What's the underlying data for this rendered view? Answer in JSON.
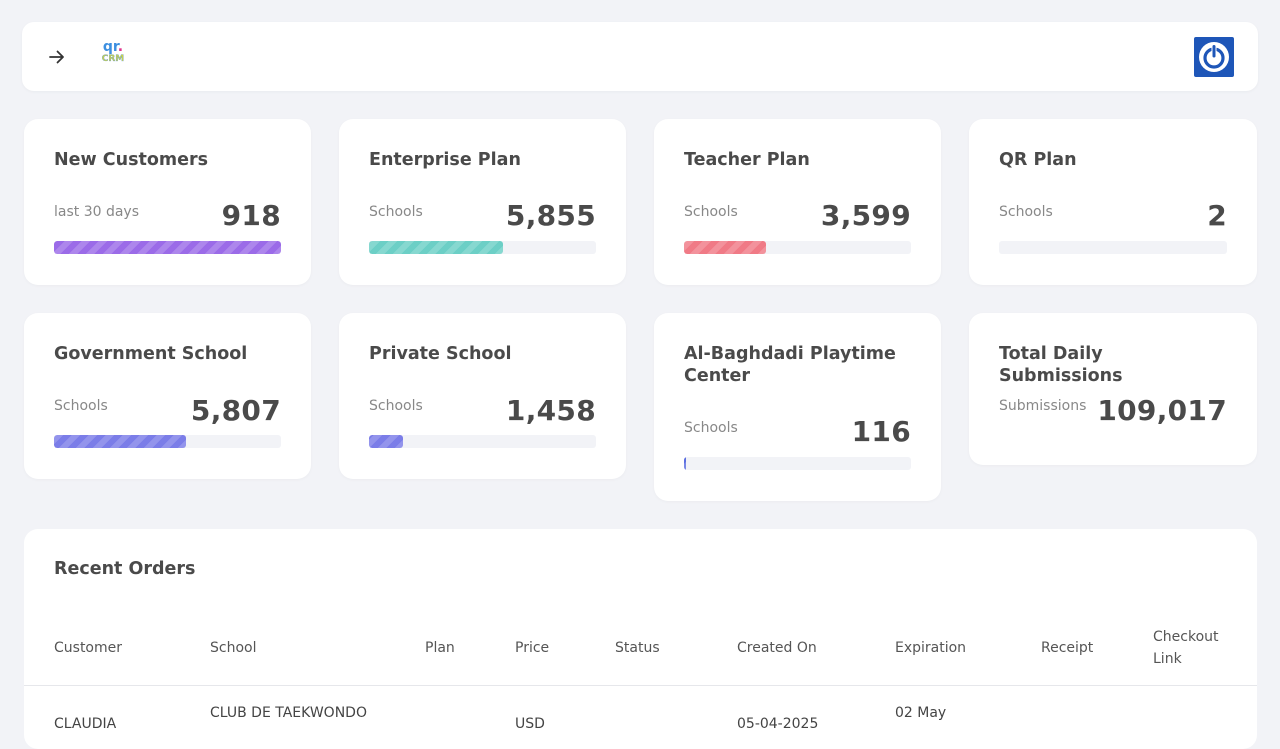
{
  "header": {
    "logo_top": "qr",
    "logo_dot": ".",
    "logo_bottom": "CRM"
  },
  "stats": [
    {
      "title": "New Customers",
      "subtitle": "last 30 days",
      "value": "918",
      "progress": 1.0,
      "color": "#9b6be8"
    },
    {
      "title": "Enterprise Plan",
      "subtitle": "Schools",
      "value": "5,855",
      "progress": 0.59,
      "color": "#6ccfc6"
    },
    {
      "title": "Teacher Plan",
      "subtitle": "Schools",
      "value": "3,599",
      "progress": 0.36,
      "color": "#f07a86"
    },
    {
      "title": "QR Plan",
      "subtitle": "Schools",
      "value": "2",
      "progress": 0.0,
      "color": "#6ccfc6"
    },
    {
      "title": "Government School",
      "subtitle": "Schools",
      "value": "5,807",
      "progress": 0.58,
      "color": "#7b7de8"
    },
    {
      "title": "Private School",
      "subtitle": "Schools",
      "value": "1,458",
      "progress": 0.15,
      "color": "#7b7de8"
    },
    {
      "title": "Al-Baghdadi Playtime Center",
      "subtitle": "Schools",
      "value": "116",
      "progress": 0.01,
      "color": "#5a6de0"
    },
    {
      "title": "Total Daily Submissions",
      "subtitle": "Submissions",
      "value": "109,017"
    }
  ],
  "orders": {
    "title": "Recent Orders",
    "columns": [
      "Customer",
      "School",
      "Plan",
      "Price",
      "Status",
      "Created On",
      "Expiration",
      "Receipt",
      "Checkout Link"
    ],
    "rows": [
      {
        "customer": "CLAUDIA",
        "school": "CLUB DE TAEKWONDO",
        "price": "USD",
        "created_on": "05-04-2025",
        "expiration": "02 May"
      }
    ]
  }
}
